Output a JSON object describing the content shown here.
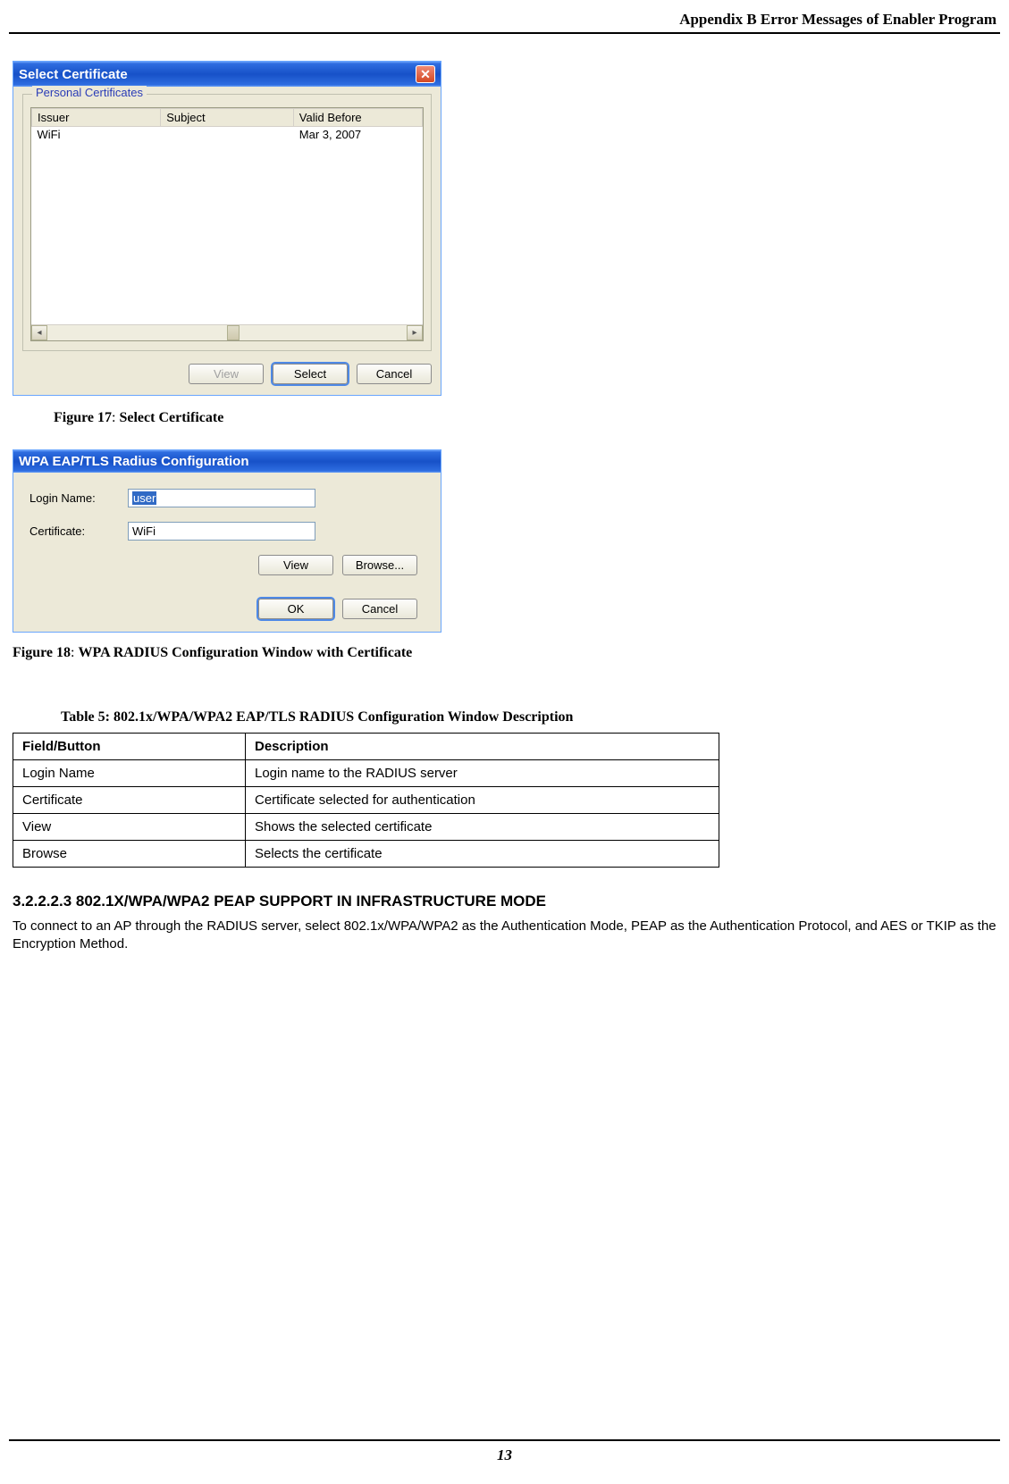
{
  "header": "Appendix B Error Messages of Enabler Program",
  "dialog1": {
    "title": "Select Certificate",
    "group_legend": "Personal Certificates",
    "columns": {
      "issuer": "Issuer",
      "subject": "Subject",
      "valid_before": "Valid Before"
    },
    "rows": [
      {
        "issuer": "WiFi",
        "subject": "",
        "valid_before": "Mar 3, 2007"
      }
    ],
    "buttons": {
      "view": "View",
      "select": "Select",
      "cancel": "Cancel"
    }
  },
  "figure17": {
    "label": "Figure 17",
    "sep": ":",
    "title": "Select Certificate"
  },
  "dialog2": {
    "title": "WPA EAP/TLS Radius Configuration",
    "labels": {
      "login": "Login Name:",
      "cert": "Certificate:"
    },
    "values": {
      "login": "user",
      "cert": "WiFi"
    },
    "buttons": {
      "view": "View",
      "browse": "Browse...",
      "ok": "OK",
      "cancel": "Cancel"
    }
  },
  "figure18": {
    "label": "Figure 18",
    "sep": ":",
    "title": "WPA RADIUS Configuration Window with Certificate"
  },
  "table5": {
    "caption_label": "Table 5",
    "caption_sep": ":",
    "caption_title": "802.1x/WPA/WPA2 EAP/TLS RADIUS Configuration Window Description",
    "header": {
      "field": "Field/Button",
      "desc": "Description"
    },
    "rows": [
      {
        "field": "Login Name",
        "desc": "Login name to the RADIUS server"
      },
      {
        "field": "Certificate",
        "desc": "Certificate selected for authentication"
      },
      {
        "field": "View",
        "desc": "Shows the selected certificate"
      },
      {
        "field": "Browse",
        "desc": "Selects the certificate"
      }
    ]
  },
  "section": {
    "heading": "3.2.2.2.3 802.1X/WPA/WPA2 PEAP SUPPORT IN INFRASTRUCTURE MODE",
    "body": "To connect to an AP through the RADIUS server, select 802.1x/WPA/WPA2 as the Authentication Mode, PEAP as the Authentication Protocol, and AES or TKIP as the Encryption Method."
  },
  "footer": "13"
}
